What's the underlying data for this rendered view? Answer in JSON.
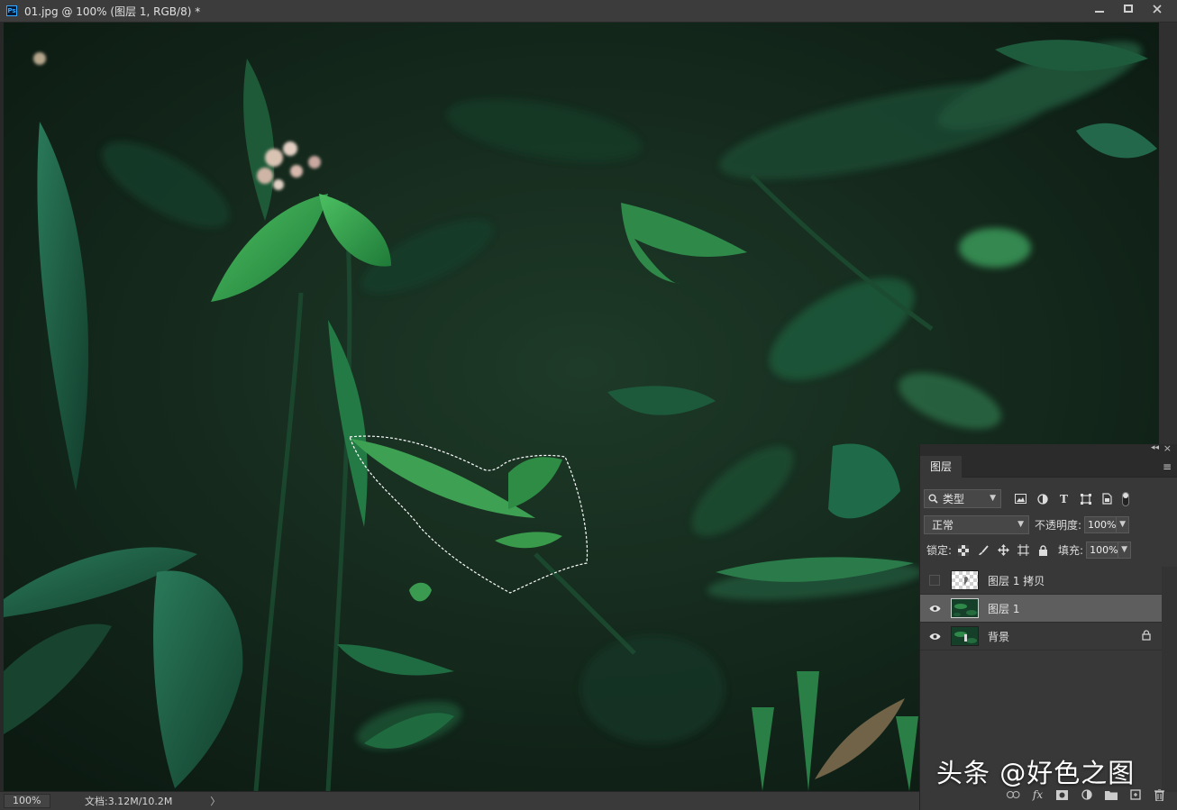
{
  "window": {
    "app_icon": "Ps",
    "title": "01.jpg @ 100% (图层 1, RGB/8) *",
    "controls": [
      "minimize-icon",
      "maximize-icon",
      "close-icon"
    ]
  },
  "statusbar": {
    "zoom": "100%",
    "doc_info": "文档:3.12M/10.2M",
    "arrow": "〉"
  },
  "layers_panel": {
    "tab_label": "图层",
    "filter": {
      "kind_label": "类型",
      "icons": [
        "image-filter-icon",
        "adjustment-filter-icon",
        "type-filter-icon",
        "shape-filter-icon",
        "smart-object-filter-icon"
      ]
    },
    "blend_mode": "正常",
    "opacity_label": "不透明度:",
    "opacity_value": "100%",
    "lock_label": "锁定:",
    "fill_label": "填充:",
    "fill_value": "100%",
    "layers": [
      {
        "name": "图层 1 拷贝",
        "visible": false,
        "active": false,
        "locked": false
      },
      {
        "name": "图层 1",
        "visible": true,
        "active": true,
        "locked": false
      },
      {
        "name": "背景",
        "visible": true,
        "active": false,
        "locked": true
      }
    ],
    "bottom_icons": [
      "link-icon",
      "fx-icon",
      "mask-icon",
      "adjustment-icon",
      "group-folder-icon",
      "new-layer-icon",
      "trash-icon"
    ]
  },
  "watermark": "头条 @好色之图",
  "colors": {
    "accent": "#31a8ff",
    "panel_bg": "#383838",
    "active_layer": "#5e5e5e",
    "foliage_dark": "#12251b",
    "foliage_bright": "#3fa14f"
  }
}
